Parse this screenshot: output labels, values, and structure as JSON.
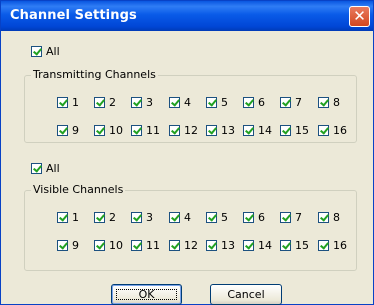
{
  "dialog": {
    "title": "Channel Settings",
    "close_label": "✕"
  },
  "transmitting": {
    "all_label": "All",
    "group_label": "Transmitting Channels",
    "channels": [
      "1",
      "2",
      "3",
      "4",
      "5",
      "6",
      "7",
      "8",
      "9",
      "10",
      "11",
      "12",
      "13",
      "14",
      "15",
      "16"
    ]
  },
  "visible": {
    "all_label": "All",
    "group_label": "Visible Channels",
    "channels": [
      "1",
      "2",
      "3",
      "4",
      "5",
      "6",
      "7",
      "8",
      "9",
      "10",
      "11",
      "12",
      "13",
      "14",
      "15",
      "16"
    ]
  },
  "buttons": {
    "ok_label": "OK",
    "cancel_label": "Cancel"
  }
}
